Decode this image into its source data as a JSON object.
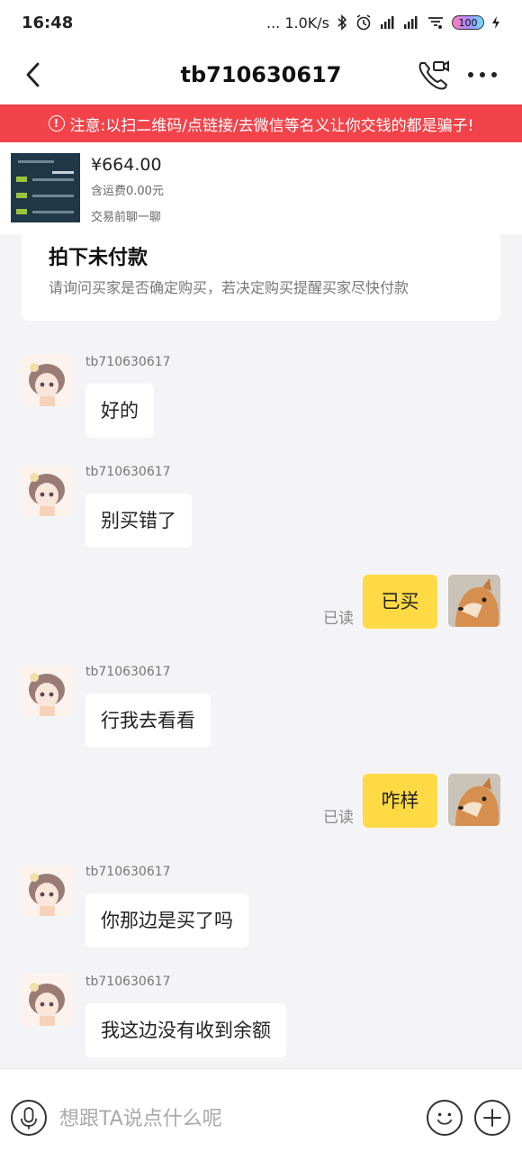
{
  "status_bar": {
    "time": "16:48",
    "network_speed": "... 1.0K/s",
    "battery": "100",
    "icons": [
      "bluetooth-icon",
      "alarm-icon",
      "signal-icon",
      "signal-icon",
      "wifi-icon",
      "battery-icon",
      "charging-icon"
    ]
  },
  "header": {
    "title": "tb710630617",
    "icons": [
      "back-arrow-icon",
      "phone-video-icon",
      "more-icon"
    ]
  },
  "warning": {
    "text": "注意:以扫二维码/点链接/去微信等名义让你交钱的都是骗子!",
    "icon": "exclamation-circle-icon",
    "color": "#f2434a"
  },
  "product": {
    "price": "¥664.00",
    "shipping": "含运费0.00元",
    "chat_hint": "交易前聊一聊"
  },
  "notice": {
    "title": "拍下未付款",
    "text": "请询问买家是否确定购买，若决定购买提醒买家尽快付款"
  },
  "chat": {
    "partner_name": "tb710630617",
    "read_label": "已读",
    "accent_color": "#ffda44",
    "messages": [
      {
        "from": "partner",
        "sender": "tb710630617",
        "text": "好的"
      },
      {
        "from": "partner",
        "sender": "tb710630617",
        "text": "别买错了"
      },
      {
        "from": "me",
        "text": "已买",
        "status": "已读"
      },
      {
        "from": "partner",
        "sender": "tb710630617",
        "text": "行我去看看"
      },
      {
        "from": "me",
        "text": "咋样",
        "status": "已读"
      },
      {
        "from": "partner",
        "sender": "tb710630617",
        "text": "你那边是买了吗"
      },
      {
        "from": "partner",
        "sender": "tb710630617",
        "text": "我这边没有收到余额"
      }
    ]
  },
  "input_bar": {
    "placeholder": "想跟TA说点什么呢",
    "icons": [
      "microphone-icon",
      "emoji-icon",
      "plus-icon"
    ]
  }
}
